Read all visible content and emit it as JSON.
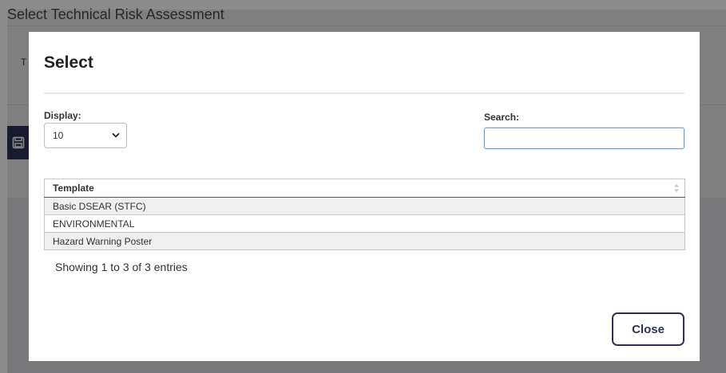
{
  "background": {
    "page_title": "Select Technical Risk Assessment",
    "partial_letter": "T"
  },
  "modal": {
    "title": "Select",
    "display": {
      "label": "Display:",
      "selected": "10"
    },
    "search": {
      "label": "Search:",
      "value": ""
    },
    "table": {
      "headers": [
        "Template"
      ],
      "rows": [
        "Basic DSEAR (STFC)",
        "ENVIRONMENTAL",
        "Hazard Warning Poster"
      ]
    },
    "info": "Showing 1 to 3 of 3 entries",
    "close_label": "Close"
  },
  "colors": {
    "accent": "#2d3154",
    "search_focus": "#6a9fd4"
  },
  "icons": {
    "save": "save-icon",
    "sort": "sort-icon",
    "dropdown": "chevron-down-icon"
  }
}
